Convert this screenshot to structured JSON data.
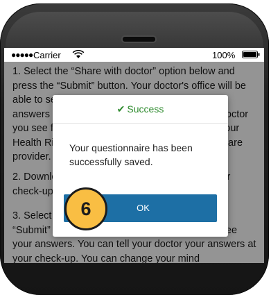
{
  "status_bar": {
    "signal": "●●●●●",
    "carrier": "Carrier",
    "battery": "100%"
  },
  "background_text": {
    "p1": "1. Select the “Share with doctor” option below and press the “Submit” button. Your doctor's office will be able to see your answers. You can still edit your answers before your appointment. NOTE: Any doctor you see for an appointment will be able to see your Health Risk Assessment, not only your primary care provider.",
    "p2": "2. Download the form and take it with you to your check-up.",
    "p3": "3. Select “Submit” without sharing and press the “Submit” button. Your doctor will not be able to see your answers. You can tell your doctor your answers at your check-up. You can change your mind"
  },
  "modal": {
    "title": "Success",
    "check_icon": "✔",
    "message": "Your questionnaire has been successfully saved.",
    "ok_label": "OK"
  },
  "step_badge": {
    "number": "6",
    "color": "#f9be43"
  },
  "colors": {
    "success_green": "#2e8b2e",
    "button_blue": "#1d6fa5"
  }
}
